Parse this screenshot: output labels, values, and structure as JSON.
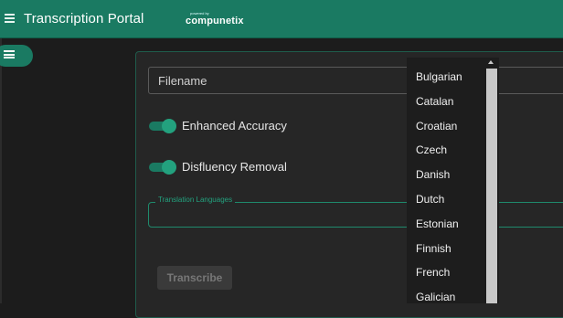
{
  "header": {
    "title": "Transcription Portal",
    "brand_powered": "powered by",
    "brand_name": "compunetix",
    "menu_icon": "hamburger-menu-icon"
  },
  "sidebar": {
    "toggle_icon": "list-icon"
  },
  "form": {
    "filename_placeholder": "Filename",
    "toggles": [
      {
        "label": "Enhanced Accuracy",
        "on": true
      },
      {
        "label": "Disfluency Removal",
        "on": true
      }
    ],
    "translation_legend": "Translation Languages",
    "transcribe_label": "Transcribe"
  },
  "dropdown": {
    "items": [
      "Bulgarian",
      "Catalan",
      "Croatian",
      "Czech",
      "Danish",
      "Dutch",
      "Estonian",
      "Finnish",
      "French",
      "Galician"
    ]
  },
  "colors": {
    "accent": "#1a7a62",
    "toggle_knob": "#23a17e",
    "background": "#1c1c1c"
  }
}
